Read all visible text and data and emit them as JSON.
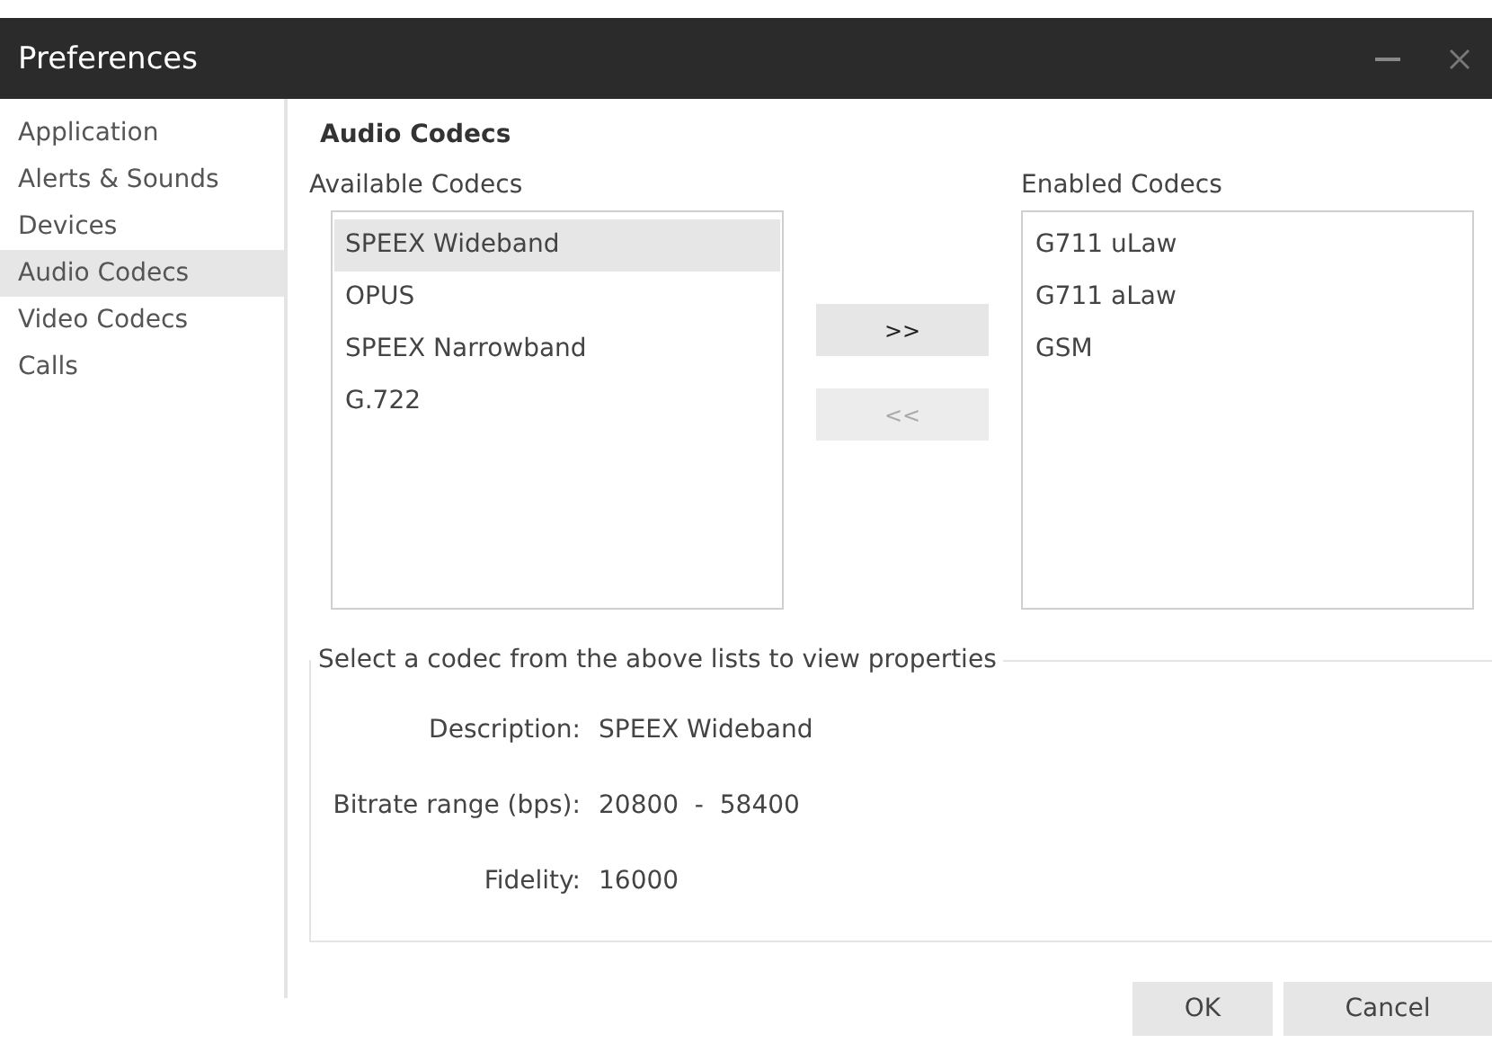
{
  "window": {
    "title": "Preferences"
  },
  "sidebar": {
    "items": [
      {
        "label": "Application",
        "selected": false
      },
      {
        "label": "Alerts & Sounds",
        "selected": false
      },
      {
        "label": "Devices",
        "selected": false
      },
      {
        "label": "Audio Codecs",
        "selected": true
      },
      {
        "label": "Video Codecs",
        "selected": false
      },
      {
        "label": "Calls",
        "selected": false
      }
    ]
  },
  "heading": "Audio Codecs",
  "available": {
    "label": "Available Codecs",
    "items": [
      {
        "label": "SPEEX Wideband",
        "selected": true
      },
      {
        "label": "OPUS",
        "selected": false
      },
      {
        "label": "SPEEX Narrowband",
        "selected": false
      },
      {
        "label": "G.722",
        "selected": false
      }
    ]
  },
  "move_buttons": [
    {
      "label": ">>",
      "disabled": false
    },
    {
      "label": "<<",
      "disabled": true
    }
  ],
  "enabled": {
    "label": "Enabled Codecs",
    "items": [
      {
        "label": "G711 uLaw",
        "selected": false
      },
      {
        "label": "G711 aLaw",
        "selected": false
      },
      {
        "label": "GSM",
        "selected": false
      }
    ]
  },
  "properties": {
    "legend": "Select a codec from the above lists to view properties",
    "rows": [
      {
        "label": "Description:",
        "value": "SPEEX Wideband"
      },
      {
        "label": "Bitrate range (bps):",
        "value": "20800  -  58400"
      },
      {
        "label": "Fidelity:",
        "value": "16000"
      }
    ]
  },
  "buttons": [
    "OK",
    "Cancel"
  ]
}
